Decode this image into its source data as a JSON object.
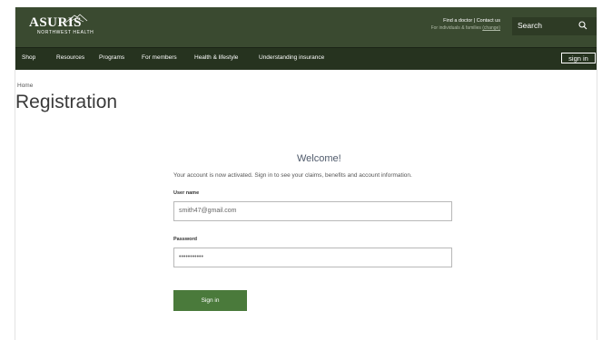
{
  "header": {
    "logo_main": "ASURIS",
    "logo_sub": "NORTHWEST HEALTH",
    "utility_links": "Find a doctor  |  Contact us",
    "utility_sub_text": "For individuals & families",
    "utility_change": "(change)",
    "search_placeholder": "Search"
  },
  "nav": {
    "items": [
      "Shop",
      "Resources",
      "Programs",
      "For members",
      "Health & lifestyle",
      "Understanding insurance"
    ],
    "signin_label": "sign in"
  },
  "breadcrumb": "Home",
  "page_title": "Registration",
  "form": {
    "welcome": "Welcome!",
    "message": "Your account is now activated. Sign in to see your claims, benefits and account information.",
    "username_label": "User name",
    "username_value": "smith47@gmail.com",
    "password_label": "Password",
    "password_value": "•••••••••••",
    "submit_label": "Sign in"
  },
  "colors": {
    "header_bg": "#3a4a30",
    "nav_bg": "#26331f",
    "button_bg": "#4a7a3b"
  }
}
